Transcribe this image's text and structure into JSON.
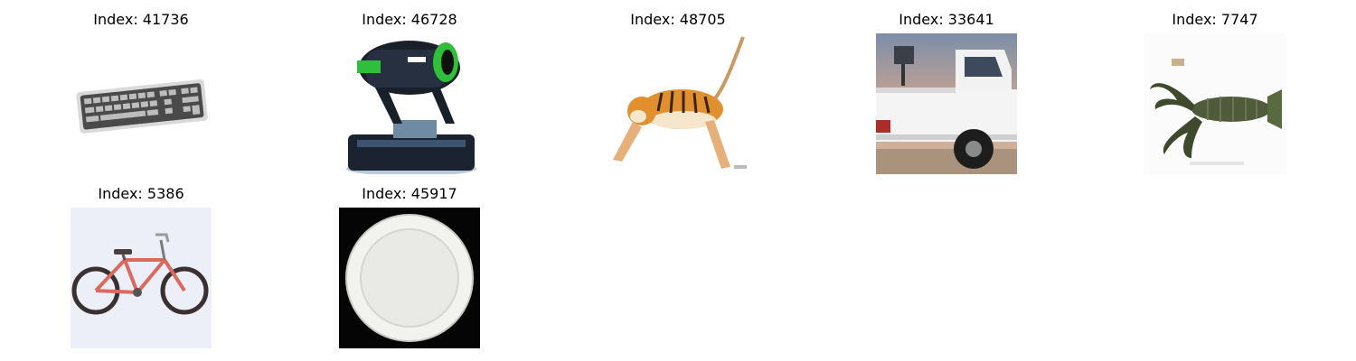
{
  "figure": {
    "images": [
      {
        "title": "Index: 41736",
        "subject": "keyboard"
      },
      {
        "title": "Index: 46728",
        "subject": "stage light"
      },
      {
        "title": "Index: 48705",
        "subject": "tiger"
      },
      {
        "title": "Index: 33641",
        "subject": "pickup truck"
      },
      {
        "title": "Index: 7747",
        "subject": "lobster"
      },
      {
        "title": "Index: 5386",
        "subject": "bicycle"
      },
      {
        "title": "Index: 45917",
        "subject": "plate"
      }
    ]
  }
}
